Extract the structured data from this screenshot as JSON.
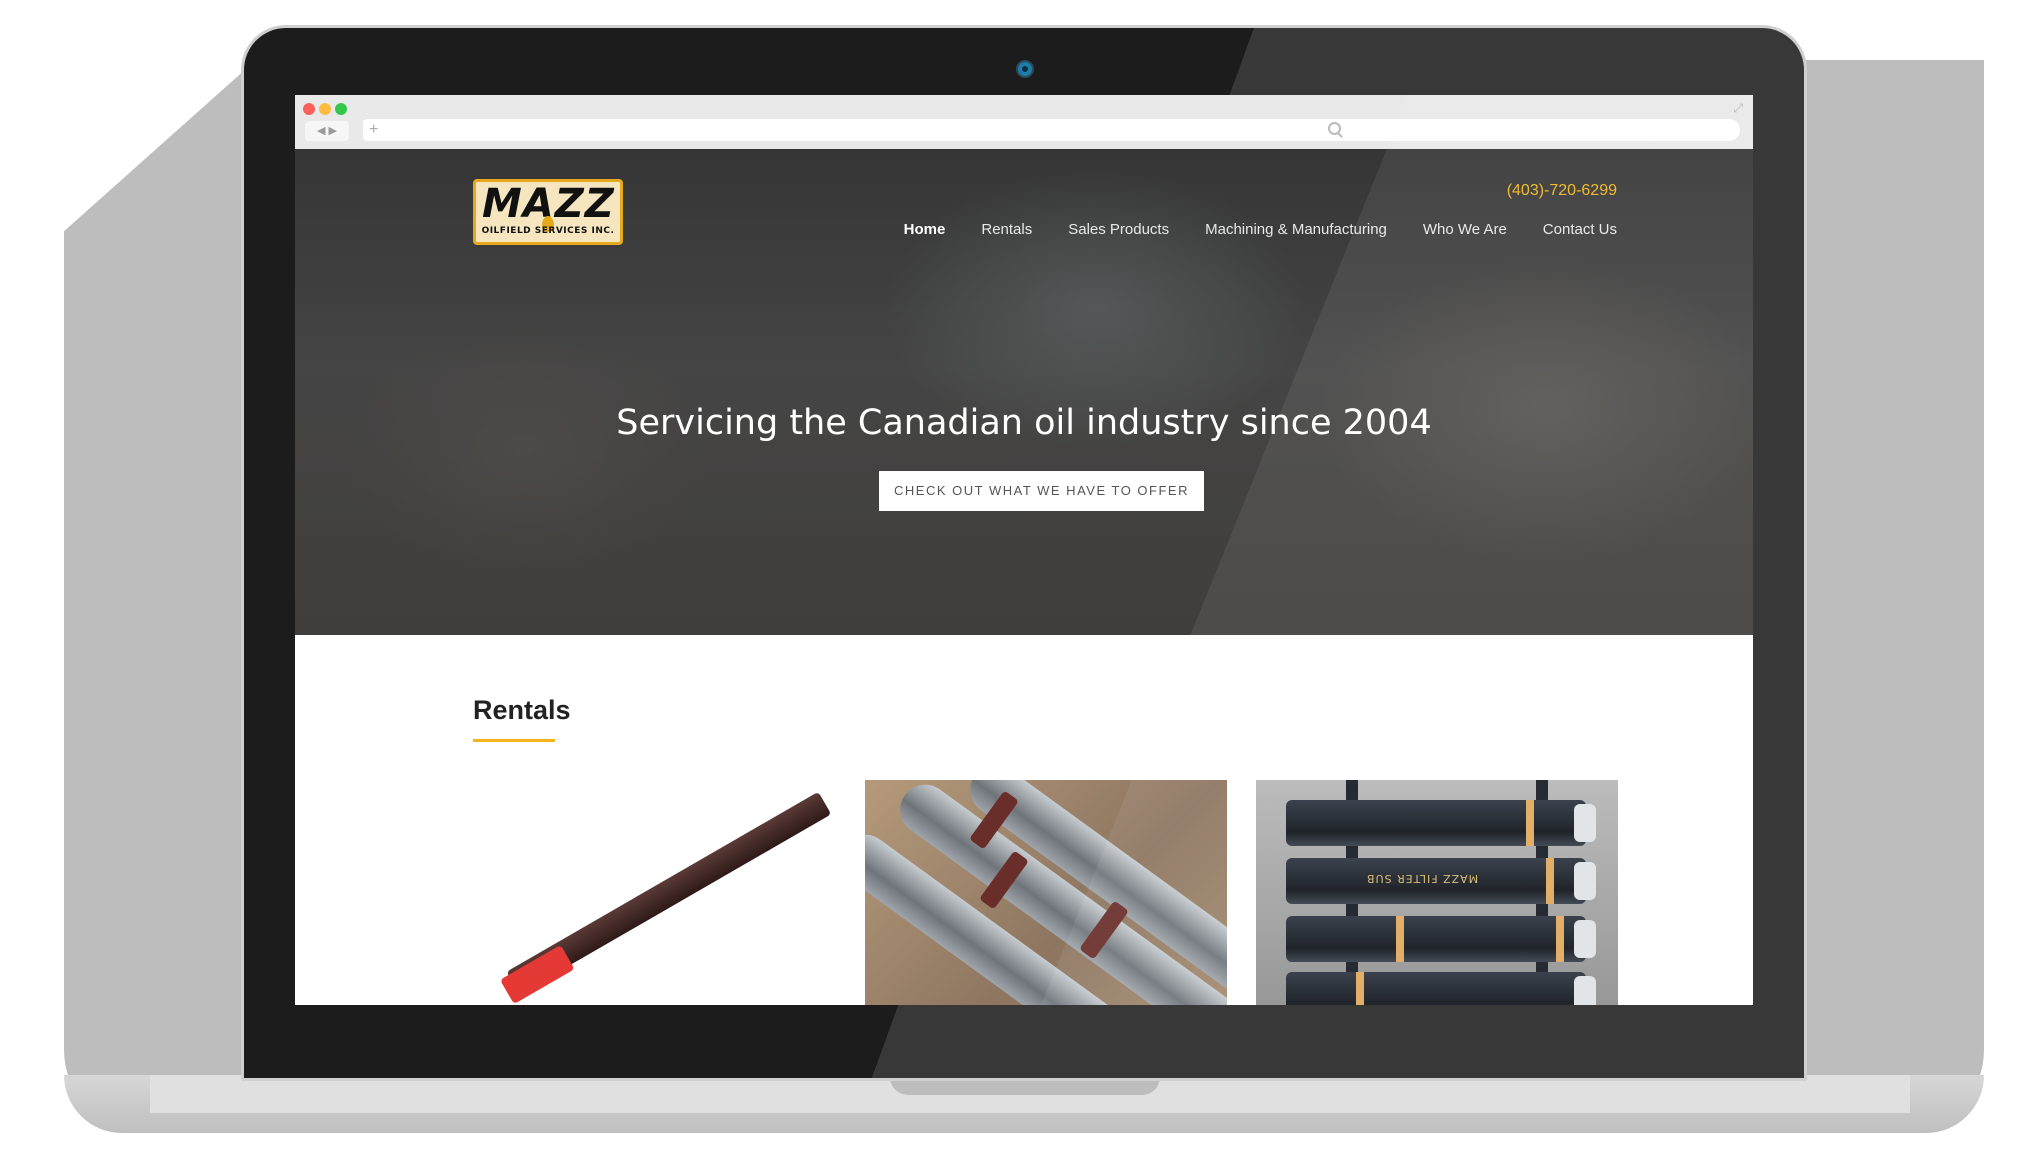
{
  "site": {
    "logo_text": "MAZZ",
    "logo_subtext": "OILFIELD SERVICES INC.",
    "phone": "(403)-720-6299",
    "nav": [
      "Home",
      "Rentals",
      "Sales Products",
      "Machining & Manufacturing",
      "Who We Are",
      "Contact Us"
    ],
    "active_nav": "Home"
  },
  "hero": {
    "title": "Servicing the Canadian oil industry since 2004",
    "cta_label": "CHECK OUT WHAT WE HAVE TO OFFER"
  },
  "rentals": {
    "title": "Rentals",
    "items": [
      "rental-tool",
      "rental-pipes",
      "rental-filter-subs"
    ],
    "filter_sub_label": "MAZZ FILTER SUB"
  },
  "colors": {
    "accent": "#f2b51e",
    "hero_text": "#ffffff",
    "heading_text": "#222222"
  },
  "browser": {
    "traffic_colors": [
      "#fc605b",
      "#fdbc40",
      "#34c84a"
    ]
  }
}
